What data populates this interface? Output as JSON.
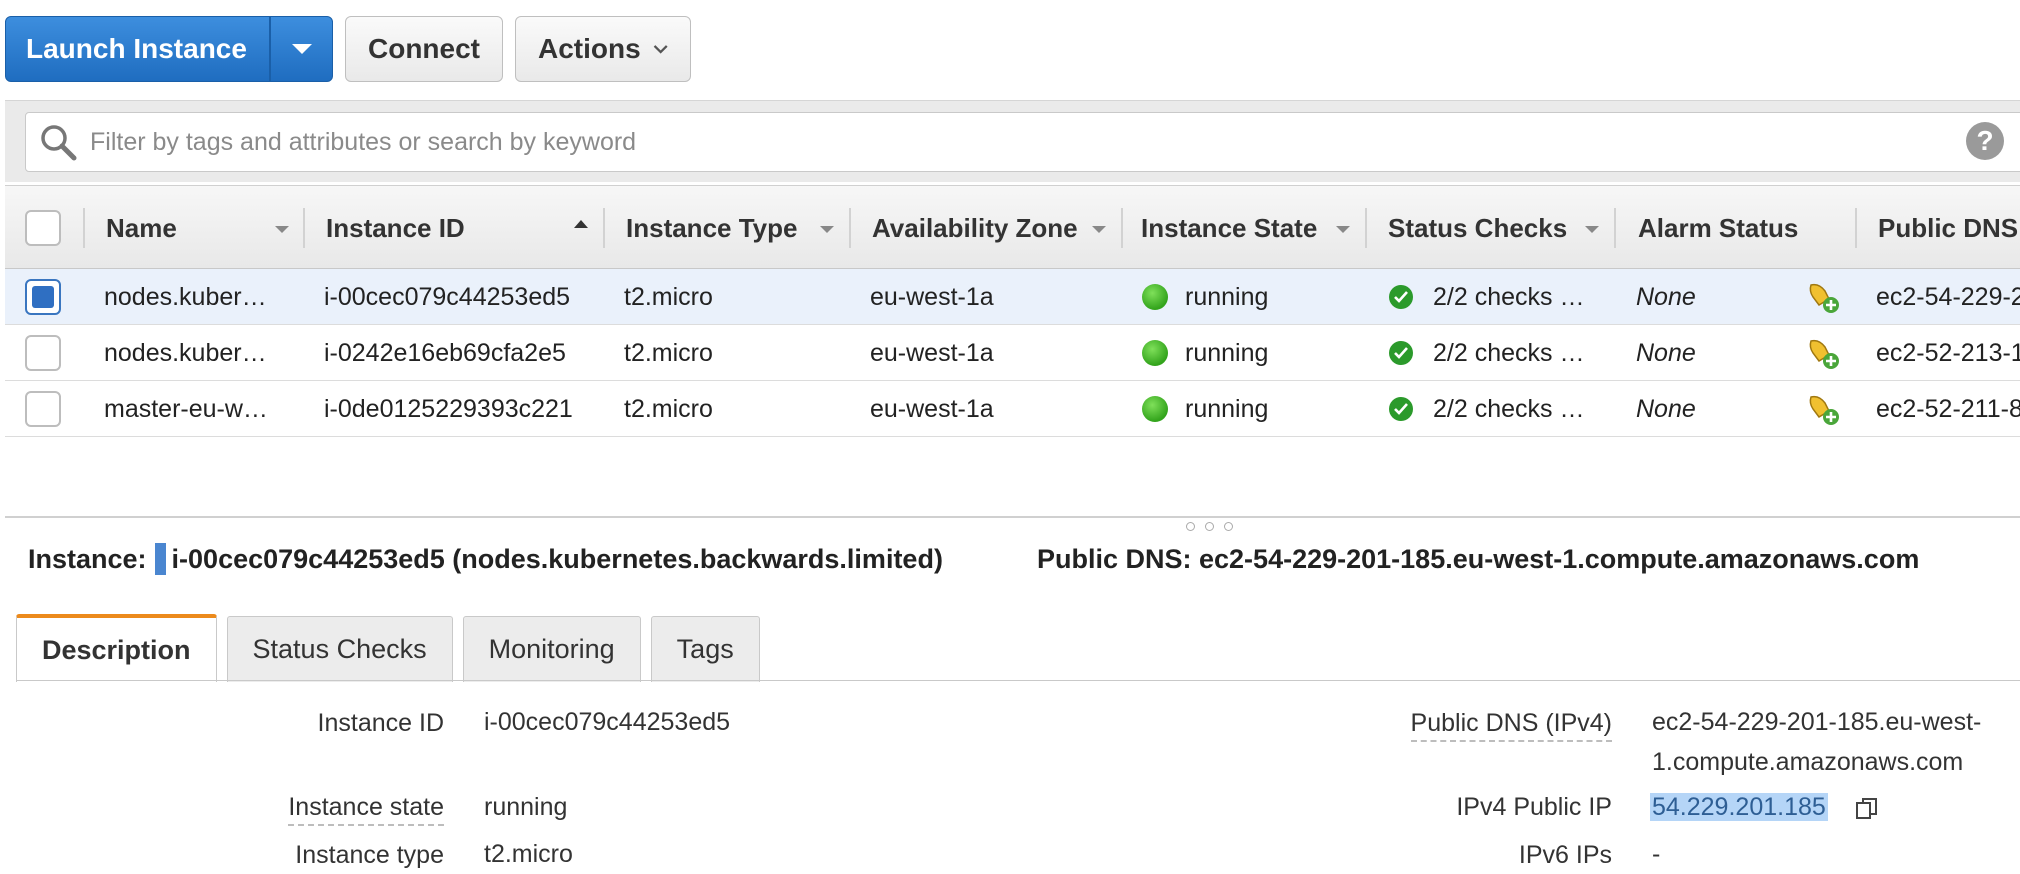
{
  "toolbar": {
    "launch_label": "Launch Instance",
    "connect_label": "Connect",
    "actions_label": "Actions"
  },
  "filter": {
    "placeholder": "Filter by tags and attributes or search by keyword"
  },
  "table": {
    "headers": {
      "name": "Name",
      "instance_id": "Instance ID",
      "instance_type": "Instance Type",
      "az": "Availability Zone",
      "state": "Instance State",
      "status_checks": "Status Checks",
      "alarm_status": "Alarm Status",
      "public_dns": "Public DNS"
    },
    "rows": [
      {
        "selected": true,
        "name": "nodes.kuber…",
        "instance_id": "i-00cec079c44253ed5",
        "instance_type": "t2.micro",
        "az": "eu-west-1a",
        "state": "running",
        "status_checks": "2/2 checks …",
        "alarm_status": "None",
        "public_dns": "ec2-54-229-2"
      },
      {
        "selected": false,
        "name": "nodes.kuber…",
        "instance_id": "i-0242e16eb69cfa2e5",
        "instance_type": "t2.micro",
        "az": "eu-west-1a",
        "state": "running",
        "status_checks": "2/2 checks …",
        "alarm_status": "None",
        "public_dns": "ec2-52-213-1"
      },
      {
        "selected": false,
        "name": "master-eu-w…",
        "instance_id": "i-0de0125229393c221",
        "instance_type": "t2.micro",
        "az": "eu-west-1a",
        "state": "running",
        "status_checks": "2/2 checks …",
        "alarm_status": "None",
        "public_dns": "ec2-52-211-8"
      }
    ]
  },
  "detail": {
    "instance_label": "Instance:",
    "instance_text": "i-00cec079c44253ed5 (nodes.kubernetes.backwards.limited)",
    "dns_text": "Public DNS: ec2-54-229-201-185.eu-west-1.compute.amazonaws.com"
  },
  "tabs": [
    "Description",
    "Status Checks",
    "Monitoring",
    "Tags"
  ],
  "description": {
    "instance_id_label": "Instance ID",
    "instance_id_value": "i-00cec079c44253ed5",
    "instance_state_label": "Instance state",
    "instance_state_value": "running",
    "instance_type_label": "Instance type",
    "instance_type_value": "t2.micro",
    "public_dns_label": "Public DNS (IPv4)",
    "public_dns_line1": "ec2-54-229-201-185.eu-west-",
    "public_dns_line2": "1.compute.amazonaws.com",
    "ipv4_label": "IPv4 Public IP",
    "ipv4_value": "54.229.201.185",
    "ipv6_label": "IPv6 IPs",
    "ipv6_value": "-"
  },
  "colors": {
    "primary_button": "#1f6dc0",
    "active_tab_accent": "#ec8a1c",
    "running_dot": "#33a41c",
    "selected_row": "#eaf1fb"
  }
}
